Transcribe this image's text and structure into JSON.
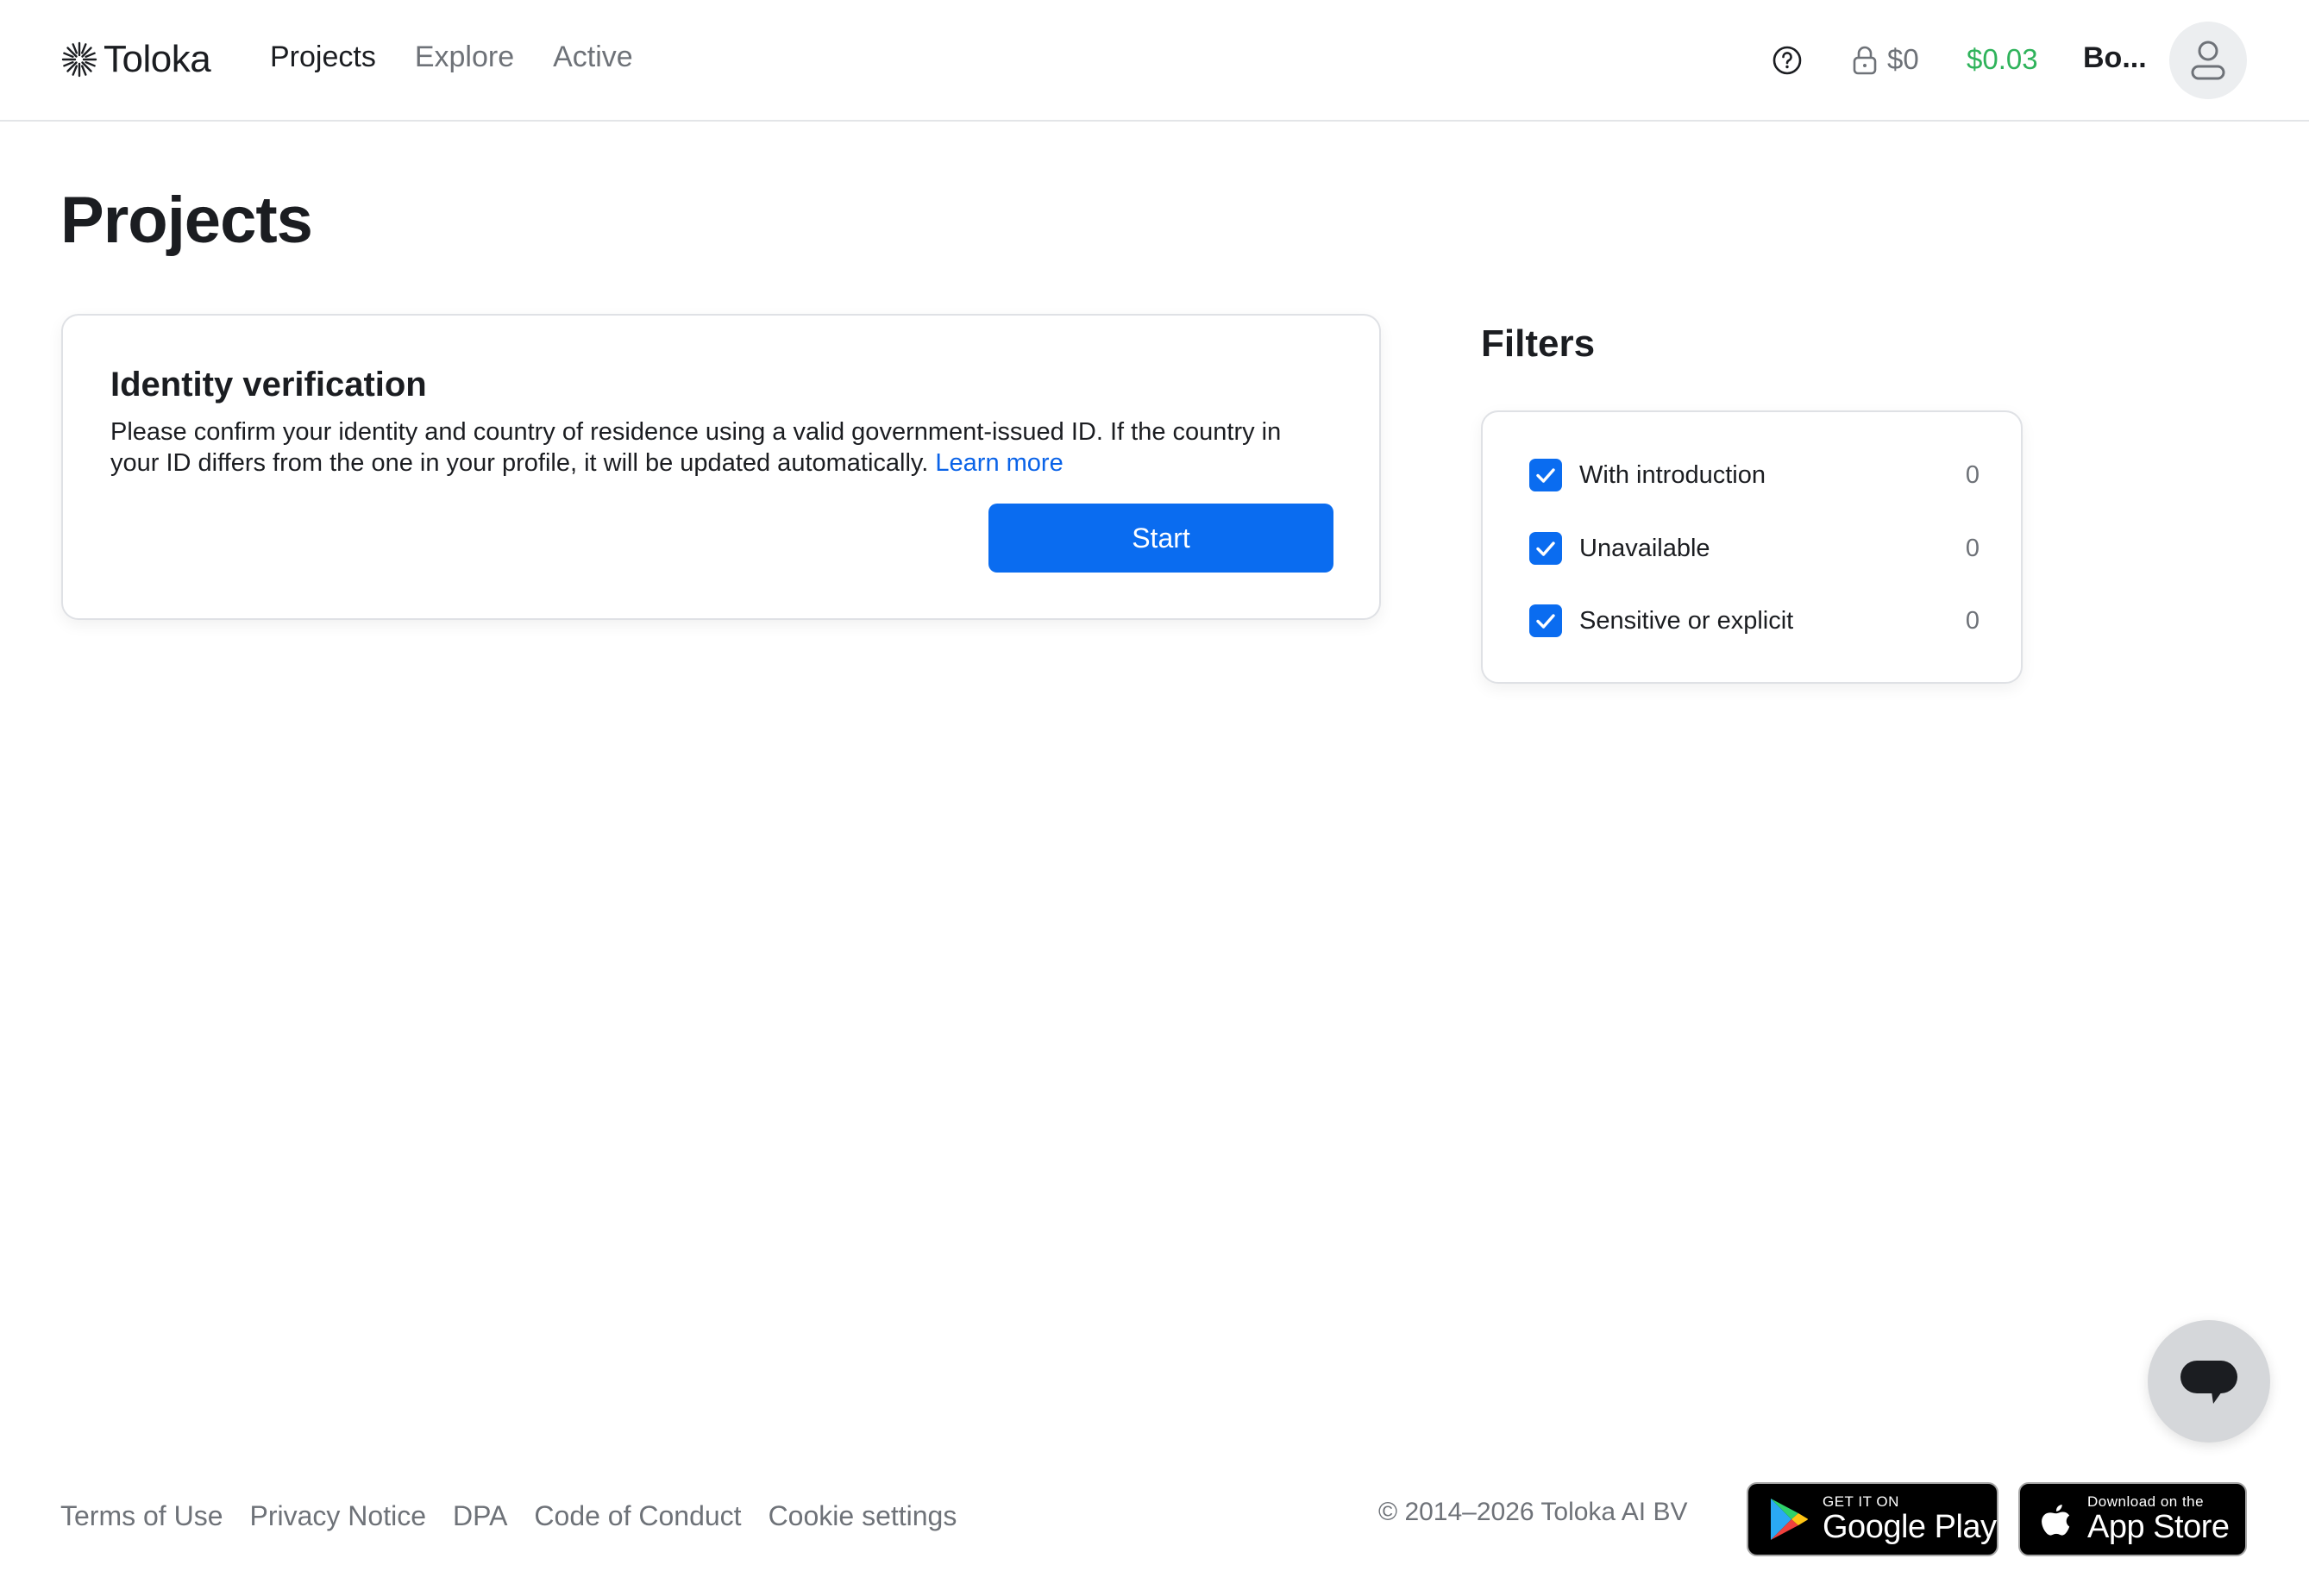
{
  "header": {
    "brand": "Toloka",
    "nav": [
      {
        "label": "Projects",
        "active": true
      },
      {
        "label": "Explore",
        "active": false
      },
      {
        "label": "Active",
        "active": false
      }
    ],
    "icons": {
      "help": "help-circle-icon",
      "lock": "lock-icon",
      "avatar": "user-icon"
    },
    "balance_locked": "$0",
    "balance_available": "$0.03",
    "user_name": "Bo..."
  },
  "main": {
    "title": "Projects",
    "verification": {
      "title": "Identity verification",
      "text": "Please confirm your identity and country of residence using a valid government-issued ID. If the country in your ID differs from the one in your profile, it will be updated automatically.",
      "link": "Learn more",
      "button": "Start"
    },
    "filters": {
      "title": "Filters",
      "items": [
        {
          "label": "With introduction",
          "count": "0",
          "checked": true
        },
        {
          "label": "Unavailable",
          "count": "0",
          "checked": true
        },
        {
          "label": "Sensitive or explicit",
          "count": "0",
          "checked": true
        }
      ]
    }
  },
  "footer": {
    "links": [
      "Terms of Use",
      "Privacy Notice",
      "DPA",
      "Code of Conduct",
      "Cookie settings"
    ],
    "copyright": "© 2014–2026 Toloka AI BV",
    "google_play": {
      "small": "GET IT ON",
      "big": "Google Play"
    },
    "app_store": {
      "small": "Download on the",
      "big": "App Store"
    }
  },
  "colors": {
    "accent": "#0a6cf0",
    "link": "#0a63e8",
    "balance_green": "#2fb35b",
    "muted": "#6e7278"
  }
}
